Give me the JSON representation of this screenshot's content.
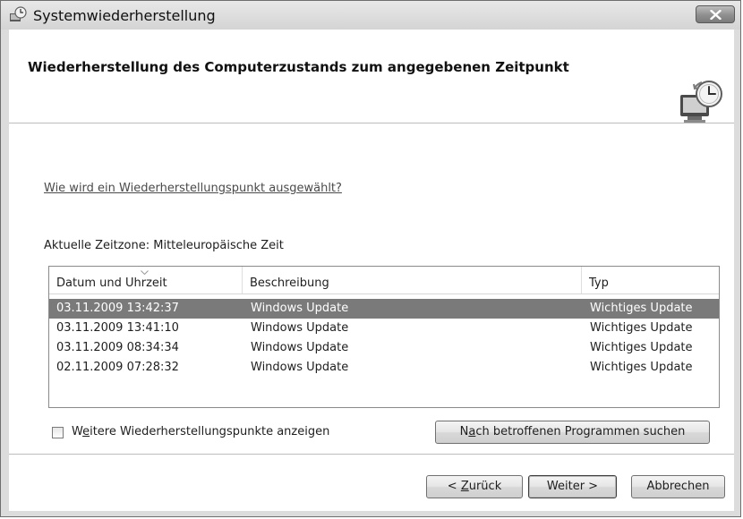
{
  "window": {
    "title": "Systemwiederherstellung"
  },
  "header": {
    "title": "Wiederherstellung des Computerzustands zum angegebenen Zeitpunkt"
  },
  "help_link": "Wie wird ein Wiederherstellungspunkt ausgewählt?",
  "timezone_label": "Aktuelle Zeitzone: Mitteleuropäische Zeit",
  "table": {
    "columns": [
      "Datum und Uhrzeit",
      "Beschreibung",
      "Typ"
    ],
    "rows": [
      {
        "date": "03.11.2009 13:42:37",
        "description": "Windows Update",
        "type": "Wichtiges Update",
        "selected": true
      },
      {
        "date": "03.11.2009 13:41:10",
        "description": "Windows Update",
        "type": "Wichtiges Update",
        "selected": false
      },
      {
        "date": "03.11.2009 08:34:34",
        "description": "Windows Update",
        "type": "Wichtiges Update",
        "selected": false
      },
      {
        "date": "02.11.2009 07:28:32",
        "description": "Windows Update",
        "type": "Wichtiges Update",
        "selected": false
      }
    ]
  },
  "more_points_checkbox": {
    "label_pre": "W",
    "label_ul": "e",
    "label_post": "itere Wiederherstellungspunkte anzeigen",
    "checked": false
  },
  "scan_button": {
    "label_pre": "N",
    "label_ul": "a",
    "label_post": "ch betroffenen Programmen suchen"
  },
  "footer": {
    "back_pre": "< ",
    "back_ul": "Z",
    "back_post": "urück",
    "next_label": "Weiter >",
    "cancel_label": "Abbrechen"
  },
  "icons": {
    "title": "system-restore-icon",
    "header": "system-restore-clock-icon",
    "close": "close-icon",
    "sort": "sort-arrow-icon"
  }
}
